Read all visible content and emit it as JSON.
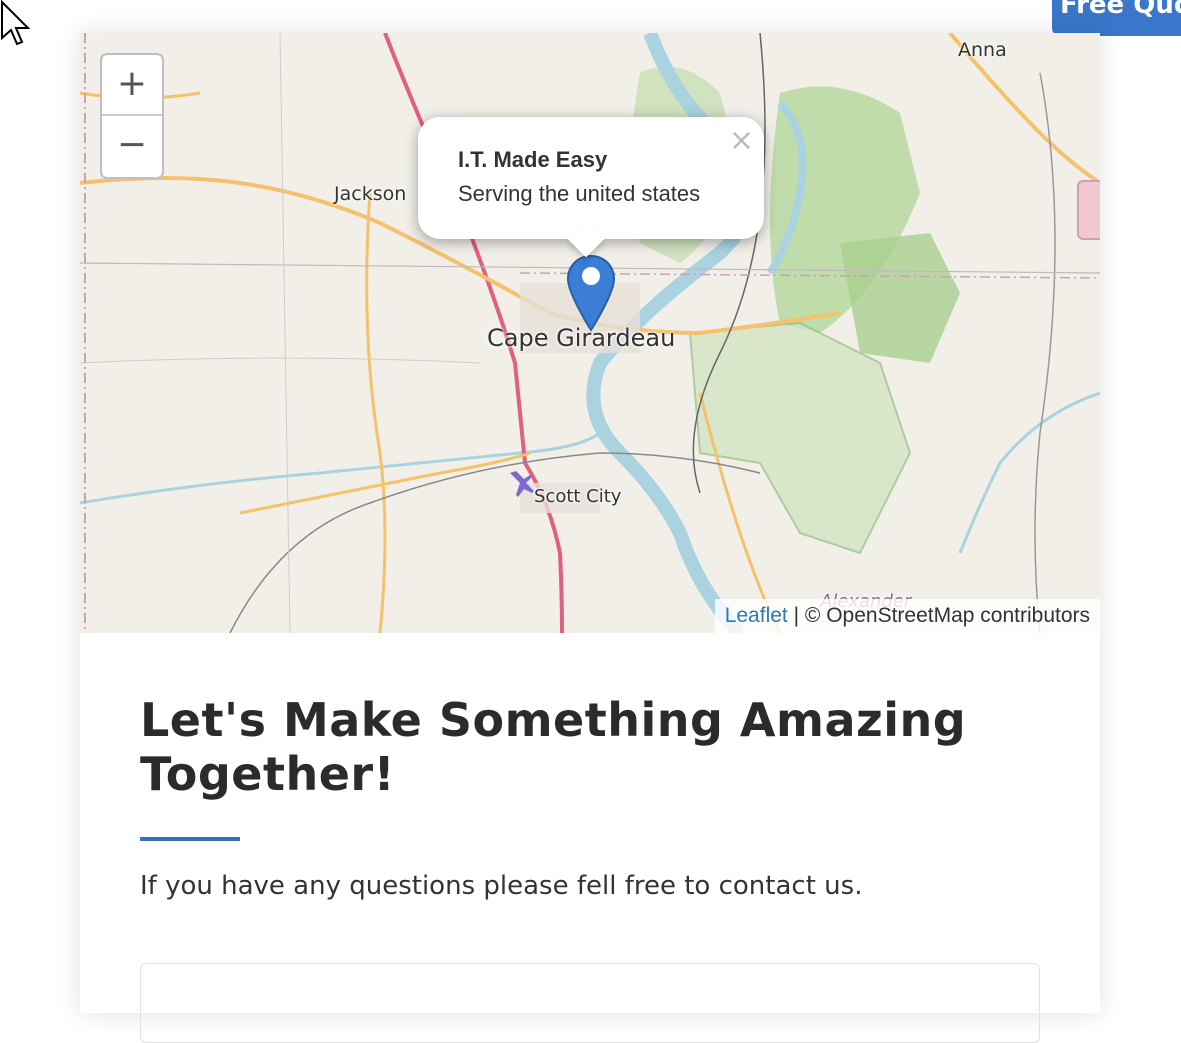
{
  "header": {
    "quote_button_label": "Free Quote"
  },
  "map": {
    "zoom_in_label": "+",
    "zoom_out_label": "−",
    "labels": {
      "jackson": "Jackson",
      "anna": "Anna",
      "cape_girardeau": "Cape Girardeau",
      "scott_city": "Scott City",
      "alexander": "Alexander"
    },
    "popup": {
      "title": "I.T. Made Easy",
      "text": "Serving the united states",
      "close_label": "×"
    },
    "attribution": {
      "link_label": "Leaflet",
      "text": " | © OpenStreetMap contributors"
    },
    "colors": {
      "marker": "#3a7fd5",
      "land": "#f2efe9",
      "water": "#aad3df",
      "forest": "#8fc07d",
      "highway": "#e0607e",
      "primary_road": "#f4c26c"
    }
  },
  "contact": {
    "heading": "Let's Make Something Amazing Together!",
    "subtext": "If you have any questions please fell free to contact us.",
    "accent_color": "#3a6fb5"
  }
}
